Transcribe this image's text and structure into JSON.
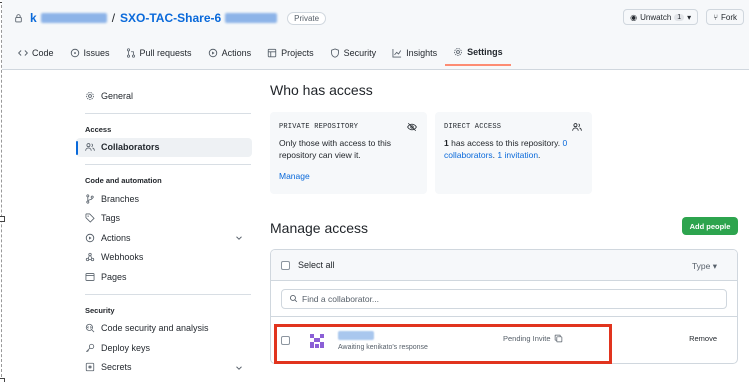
{
  "repo": {
    "owner_initial": "k",
    "separator": "/",
    "name": "SXO-TAC-Share-6",
    "visibility": "Private"
  },
  "head_actions": {
    "unwatch_label": "Unwatch",
    "unwatch_count": "1",
    "fork_label": "Fork"
  },
  "tabs": [
    {
      "label": "Code",
      "icon": "code-icon"
    },
    {
      "label": "Issues",
      "icon": "issue-icon"
    },
    {
      "label": "Pull requests",
      "icon": "pull-request-icon"
    },
    {
      "label": "Actions",
      "icon": "play-icon"
    },
    {
      "label": "Projects",
      "icon": "table-icon"
    },
    {
      "label": "Security",
      "icon": "shield-icon"
    },
    {
      "label": "Insights",
      "icon": "graph-icon"
    },
    {
      "label": "Settings",
      "icon": "gear-icon",
      "active": true
    }
  ],
  "sidebar": {
    "general": "General",
    "access_heading": "Access",
    "collaborators": "Collaborators",
    "code_heading": "Code and automation",
    "branches": "Branches",
    "tags": "Tags",
    "actions": "Actions",
    "webhooks": "Webhooks",
    "pages": "Pages",
    "security_heading": "Security",
    "code_security": "Code security and analysis",
    "deploy_keys": "Deploy keys",
    "secrets": "Secrets"
  },
  "who_has_access": {
    "title": "Who has access",
    "private_card": {
      "title": "PRIVATE REPOSITORY",
      "text": "Only those with access to this repository can view it.",
      "link": "Manage"
    },
    "direct_card": {
      "title": "DIRECT ACCESS",
      "count": "1",
      "text_mid": " has access to this repository. ",
      "collab_link": "0 collaborators",
      "dot": ". ",
      "invite_link": "1 invitation",
      "end": "."
    }
  },
  "manage_access": {
    "title": "Manage access",
    "add_button": "Add people",
    "select_all": "Select all",
    "type_filter": "Type ▾",
    "search_placeholder": "Find a collaborator...",
    "member": {
      "subtitle": "Awaiting kenikato's response",
      "status": "Pending Invite",
      "remove": "Remove"
    }
  },
  "colors": {
    "accent": "#0969da",
    "add_button": "#2da44e",
    "highlight": "#e1341e",
    "tab_underline": "#fd8c73"
  }
}
